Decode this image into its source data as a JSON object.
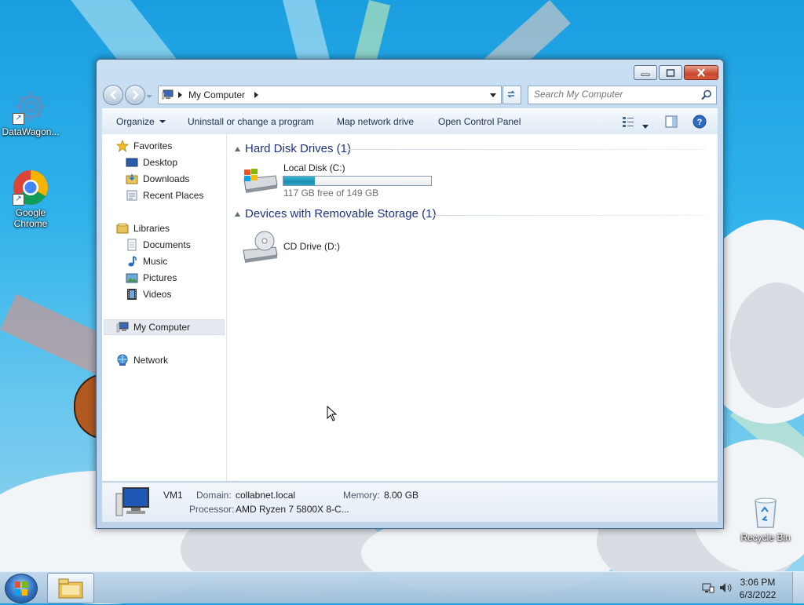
{
  "desktop": {
    "icons": [
      {
        "label": "DataWagon..."
      },
      {
        "label": "Google Chrome"
      },
      {
        "label": "Recycle Bin"
      }
    ]
  },
  "window": {
    "address": {
      "crumb": "My Computer"
    },
    "search": {
      "placeholder": "Search My Computer"
    },
    "toolbar": {
      "organize": "Organize",
      "uninstall": "Uninstall or change a program",
      "map_drive": "Map network drive",
      "control_panel": "Open Control Panel"
    },
    "nav": {
      "favorites": "Favorites",
      "desktop": "Desktop",
      "downloads": "Downloads",
      "recent": "Recent Places",
      "libraries": "Libraries",
      "documents": "Documents",
      "music": "Music",
      "pictures": "Pictures",
      "videos": "Videos",
      "computer": "My Computer",
      "network": "Network"
    },
    "groups": {
      "hdd": "Hard Disk Drives (1)",
      "removable": "Devices with Removable Storage (1)"
    },
    "drives": {
      "c": {
        "name": "Local Disk (C:)",
        "free": "117 GB free of 149 GB",
        "used_fraction": 0.215
      },
      "d": {
        "name": "CD Drive (D:)"
      }
    },
    "status": {
      "computer_name": "VM1",
      "domain_label": "Domain:",
      "domain_value": "collabnet.local",
      "memory_label": "Memory:",
      "memory_value": "8.00 GB",
      "processor_label": "Processor:",
      "processor_value": "AMD Ryzen 7 5800X 8-C..."
    }
  },
  "taskbar": {
    "time": "3:06 PM",
    "date": "6/3/2022"
  }
}
